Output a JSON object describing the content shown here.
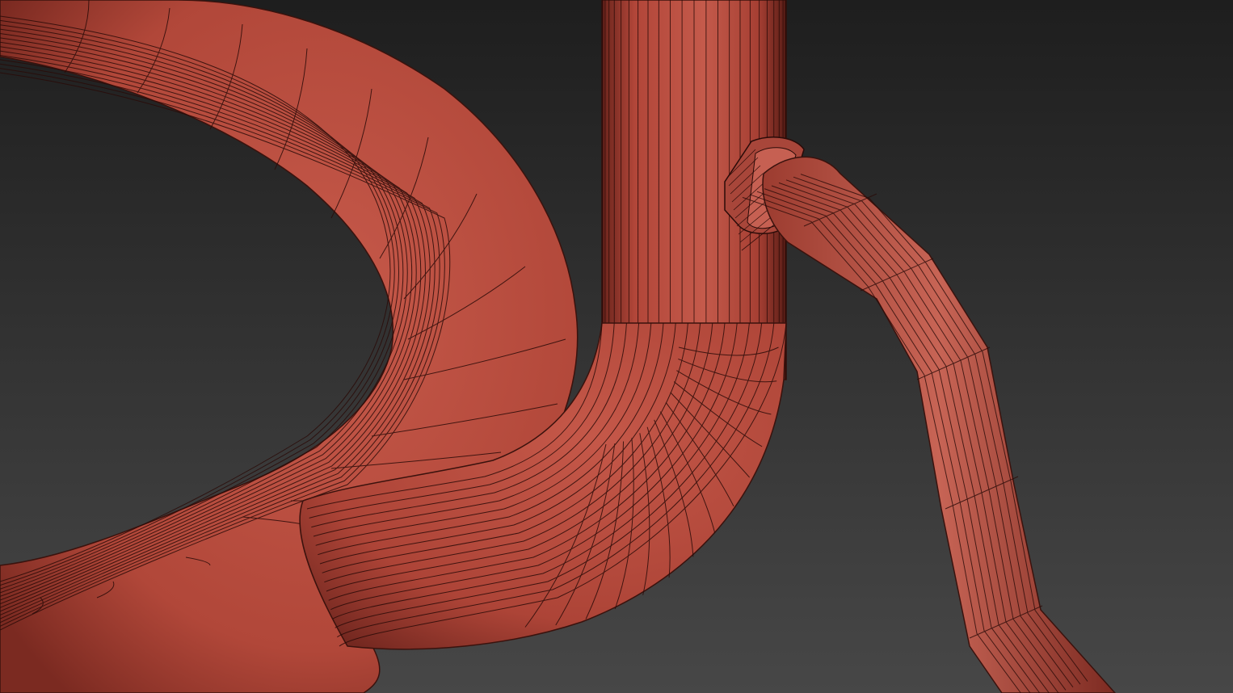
{
  "viewport": {
    "render_mode": "shaded-with-wireframe",
    "background_top": "#1e1e1e",
    "background_bottom": "#474747"
  },
  "objects": [
    {
      "name": "torus-loop-pipe",
      "kind": "torus segment"
    },
    {
      "name": "u-bend-pipe",
      "kind": "elbow pipe"
    },
    {
      "name": "vertical-pipe",
      "kind": "straight pipe"
    },
    {
      "name": "pipe-collar",
      "kind": "flange ring"
    },
    {
      "name": "branch-pipe",
      "kind": "bent pipe"
    }
  ],
  "material": {
    "base_color": "#b94a3c",
    "shadow_color": "#5e1f19",
    "highlight_color": "#d06a5c",
    "wire_color": "#2a0b08"
  }
}
